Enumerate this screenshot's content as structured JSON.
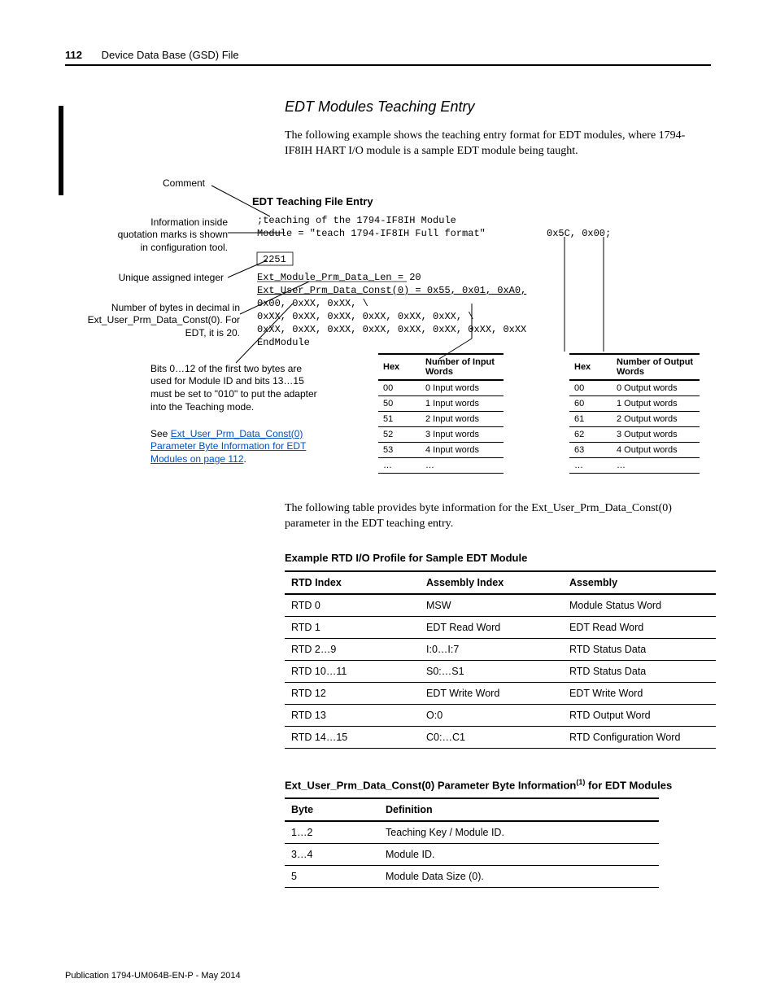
{
  "header": {
    "page_number": "112",
    "chapter": "Device Data Base (GSD) File"
  },
  "section": {
    "title": "EDT Modules Teaching Entry",
    "intro": "The following example shows the teaching entry format for EDT modules, where 1794-IF8IH HART I/O module is a sample EDT module being taught."
  },
  "diagram": {
    "heading": "EDT Teaching File Entry",
    "ann_comment": "Comment",
    "ann_info": "Information inside quotation marks is shown in configuration tool.",
    "ann_unique": "Unique assigned integer",
    "ann_numbytes": "Number of bytes in decimal in Ext_User_Prm_Data_Const(0). For EDT, it is 20.",
    "code_l1": ";teaching of the 1794-IF8IH Module",
    "code_l2a": "Module = \"teach 1794-IF8IH Full format\"",
    "code_l2b": "0x5C, 0x00;",
    "code_l3": "2251",
    "code_l4": "Ext_Module_Prm_Data_Len = 20",
    "code_l5": "Ext_User_Prm_Data_Const(0) = 0x55, 0x01, 0xA0,",
    "code_l6": "0x00, 0xXX, 0xXX, \\",
    "code_l7": "0xXX, 0xXX, 0xXX, 0xXX, 0xXX, 0xXX, \\",
    "code_l8": "0xXX, 0xXX, 0xXX, 0xXX, 0xXX, 0xXX, 0xXX, 0xXX",
    "code_l9": "EndModule",
    "bits_text": "Bits 0…12 of the first two bytes are used for Module ID and bits 13…15 must be set to \"010\" to put the adapter into the Teaching mode.",
    "see_text_pre": "See ",
    "see_link": "Ext_User_Prm_Data_Const(0) Parameter Byte Information for EDT Modules on page 112",
    "see_text_post": "."
  },
  "input_table": {
    "h1": "Hex",
    "h2": "Number of Input Words",
    "rows": [
      {
        "hex": "00",
        "words": "0 Input words"
      },
      {
        "hex": "50",
        "words": "1 Input words"
      },
      {
        "hex": "51",
        "words": "2 Input words"
      },
      {
        "hex": "52",
        "words": "3 Input words"
      },
      {
        "hex": "53",
        "words": "4 Input words"
      },
      {
        "hex": "…",
        "words": "…"
      }
    ]
  },
  "output_table": {
    "h1": "Hex",
    "h2": "Number of Output Words",
    "rows": [
      {
        "hex": "00",
        "words": "0 Output words"
      },
      {
        "hex": "60",
        "words": "1 Output words"
      },
      {
        "hex": "61",
        "words": "2 Output words"
      },
      {
        "hex": "62",
        "words": "3 Output words"
      },
      {
        "hex": "63",
        "words": "4 Output words"
      },
      {
        "hex": "…",
        "words": "…"
      }
    ]
  },
  "byte_info_intro": "The following table provides byte information for the Ext_User_Prm_Data_Const(0) parameter in the EDT teaching entry.",
  "rtd_caption": "Example RTD I/O Profile for Sample EDT Module",
  "rtd_table": {
    "h1": "RTD Index",
    "h2": "Assembly Index",
    "h3": "Assembly",
    "rows": [
      {
        "c1": "RTD 0",
        "c2": "MSW",
        "c3": "Module Status Word"
      },
      {
        "c1": "RTD 1",
        "c2": "EDT Read Word",
        "c3": "EDT Read Word"
      },
      {
        "c1": "RTD 2…9",
        "c2": "I:0…I:7",
        "c3": "RTD Status Data"
      },
      {
        "c1": "RTD 10…11",
        "c2": "S0:…S1",
        "c3": "RTD Status Data"
      },
      {
        "c1": "RTD 12",
        "c2": "EDT Write Word",
        "c3": "EDT Write Word"
      },
      {
        "c1": "RTD 13",
        "c2": "O:0",
        "c3": "RTD Output Word"
      },
      {
        "c1": "RTD 14…15",
        "c2": "C0:…C1",
        "c3": "RTD Configuration Word"
      }
    ]
  },
  "byte_caption_pre": "Ext_User_Prm_Data_Const(0) Parameter Byte Information",
  "byte_caption_sup": "(1)",
  "byte_caption_post": " for EDT Modules",
  "byte_table": {
    "h1": "Byte",
    "h2": "Definition",
    "rows": [
      {
        "c1": "1…2",
        "c2": "Teaching Key / Module ID."
      },
      {
        "c1": "3…4",
        "c2": "Module ID."
      },
      {
        "c1": "5",
        "c2": "Module Data Size (0)."
      }
    ]
  },
  "footer": "Publication 1794-UM064B-EN-P - May 2014"
}
